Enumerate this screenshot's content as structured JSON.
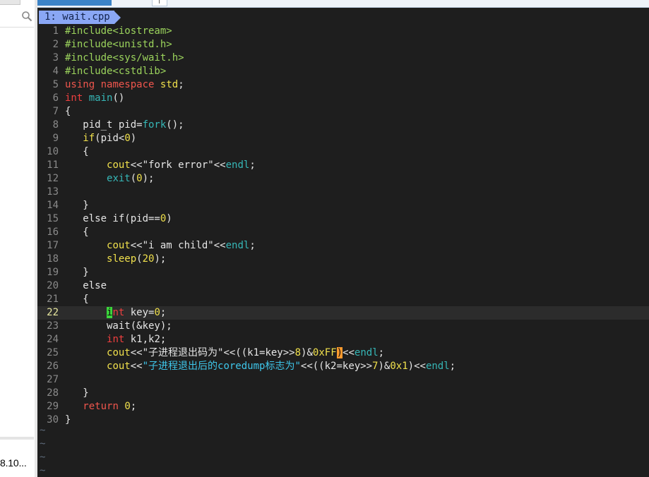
{
  "sidebar": {
    "truncated_text": "8.10..."
  },
  "buffer_tab": {
    "label": "1: wait.cpp"
  },
  "code_lines": [
    {
      "n": "1",
      "tokens": [
        [
          "pp",
          "#include<iostream>"
        ]
      ]
    },
    {
      "n": "2",
      "tokens": [
        [
          "pp",
          "#include<unistd.h>"
        ]
      ]
    },
    {
      "n": "3",
      "tokens": [
        [
          "pp",
          "#include<sys/wait.h>"
        ]
      ]
    },
    {
      "n": "4",
      "tokens": [
        [
          "pp",
          "#include<cstdlib>"
        ]
      ]
    },
    {
      "n": "5",
      "tokens": [
        [
          "kw",
          "using"
        ],
        [
          "pl",
          " "
        ],
        [
          "kw",
          "namespace"
        ],
        [
          "pl",
          " "
        ],
        [
          "nu",
          "std"
        ],
        [
          "pl",
          ";"
        ]
      ]
    },
    {
      "n": "6",
      "tokens": [
        [
          "ty",
          "int"
        ],
        [
          "pl",
          " "
        ],
        [
          "fn",
          "main"
        ],
        [
          "pl",
          "()"
        ]
      ]
    },
    {
      "n": "7",
      "tokens": [
        [
          "pl",
          "{"
        ]
      ]
    },
    {
      "n": "8",
      "tokens": [
        [
          "pl",
          "   pid_t pid="
        ],
        [
          "fn",
          "fork"
        ],
        [
          "pl",
          "();"
        ]
      ]
    },
    {
      "n": "9",
      "tokens": [
        [
          "pl",
          "   "
        ],
        [
          "nu",
          "if"
        ],
        [
          "pl",
          "(pid<"
        ],
        [
          "nu",
          "0"
        ],
        [
          "pl",
          ")"
        ]
      ]
    },
    {
      "n": "10",
      "tokens": [
        [
          "pl",
          "   {"
        ]
      ]
    },
    {
      "n": "11",
      "tokens": [
        [
          "pl",
          "       "
        ],
        [
          "nu",
          "cout"
        ],
        [
          "pl",
          "<<"
        ],
        [
          "st",
          "\"fork error\""
        ],
        [
          "pl",
          "<<"
        ],
        [
          "fn",
          "endl"
        ],
        [
          "pl",
          ";"
        ]
      ]
    },
    {
      "n": "12",
      "tokens": [
        [
          "pl",
          "       "
        ],
        [
          "fn",
          "exit"
        ],
        [
          "pl",
          "("
        ],
        [
          "nu",
          "0"
        ],
        [
          "pl",
          ");"
        ]
      ]
    },
    {
      "n": "13",
      "tokens": []
    },
    {
      "n": "14",
      "tokens": [
        [
          "pl",
          "   }"
        ]
      ]
    },
    {
      "n": "15",
      "tokens": [
        [
          "pl",
          "   else if(pid=="
        ],
        [
          "nu",
          "0"
        ],
        [
          "pl",
          ")"
        ]
      ]
    },
    {
      "n": "16",
      "tokens": [
        [
          "pl",
          "   {"
        ]
      ]
    },
    {
      "n": "17",
      "tokens": [
        [
          "pl",
          "       "
        ],
        [
          "nu",
          "cout"
        ],
        [
          "pl",
          "<<"
        ],
        [
          "st",
          "\"i am child\""
        ],
        [
          "pl",
          "<<"
        ],
        [
          "fn",
          "endl"
        ],
        [
          "pl",
          ";"
        ]
      ]
    },
    {
      "n": "18",
      "tokens": [
        [
          "pl",
          "       "
        ],
        [
          "nu",
          "sleep"
        ],
        [
          "pl",
          "("
        ],
        [
          "nu",
          "20"
        ],
        [
          "pl",
          ");"
        ]
      ]
    },
    {
      "n": "19",
      "tokens": [
        [
          "pl",
          "   }"
        ]
      ]
    },
    {
      "n": "20",
      "tokens": [
        [
          "pl",
          "   else"
        ]
      ]
    },
    {
      "n": "21",
      "tokens": [
        [
          "pl",
          "   {"
        ]
      ]
    },
    {
      "n": "22",
      "current": true,
      "tokens": [
        [
          "pl",
          "       "
        ],
        [
          "cursor",
          "i"
        ],
        [
          "ty",
          "nt"
        ],
        [
          "pl",
          " key="
        ],
        [
          "nu",
          "0"
        ],
        [
          "pl",
          ";"
        ]
      ]
    },
    {
      "n": "23",
      "tokens": [
        [
          "pl",
          "       wait(&key);"
        ]
      ]
    },
    {
      "n": "24",
      "tokens": [
        [
          "pl",
          "       "
        ],
        [
          "ty",
          "int"
        ],
        [
          "pl",
          " k1,k2;"
        ]
      ]
    },
    {
      "n": "25",
      "tokens": [
        [
          "pl",
          "       "
        ],
        [
          "nu",
          "cout"
        ],
        [
          "pl",
          "<<"
        ],
        [
          "st",
          "\"子进程退出码为\""
        ],
        [
          "pl",
          "<<((k1=key>>"
        ],
        [
          "nu",
          "8"
        ],
        [
          "pl",
          ")&"
        ],
        [
          "nu",
          "0xFF"
        ],
        [
          "match",
          ")"
        ],
        [
          "pl",
          "<<"
        ],
        [
          "fn",
          "endl"
        ],
        [
          "pl",
          ";"
        ]
      ]
    },
    {
      "n": "26",
      "tokens": [
        [
          "pl",
          "       "
        ],
        [
          "nu",
          "cout"
        ],
        [
          "pl",
          "<<"
        ],
        [
          "cs",
          "\"子进程退出后的coredump标志为\""
        ],
        [
          "pl",
          "<<((k2=key>>"
        ],
        [
          "nu",
          "7"
        ],
        [
          "pl",
          ")&"
        ],
        [
          "nu",
          "0x1"
        ],
        [
          "pl",
          ")<<"
        ],
        [
          "fn",
          "endl"
        ],
        [
          "pl",
          ";"
        ]
      ]
    },
    {
      "n": "27",
      "tokens": []
    },
    {
      "n": "28",
      "tokens": [
        [
          "pl",
          "   }"
        ]
      ]
    },
    {
      "n": "29",
      "tokens": [
        [
          "pl",
          "   "
        ],
        [
          "kw",
          "return"
        ],
        [
          "pl",
          " "
        ],
        [
          "nu",
          "0"
        ],
        [
          "pl",
          ";"
        ]
      ]
    },
    {
      "n": "30",
      "tokens": [
        [
          "pl",
          "}"
        ]
      ]
    }
  ],
  "tilde_rows": [
    "~",
    "~",
    "~",
    "~"
  ],
  "colors": {
    "terminal_bg": "#1e1e1e",
    "buffer_tab_bg": "#8aa7f5",
    "cursor": "#3bd63b",
    "match_paren": "#ff9a2e"
  }
}
